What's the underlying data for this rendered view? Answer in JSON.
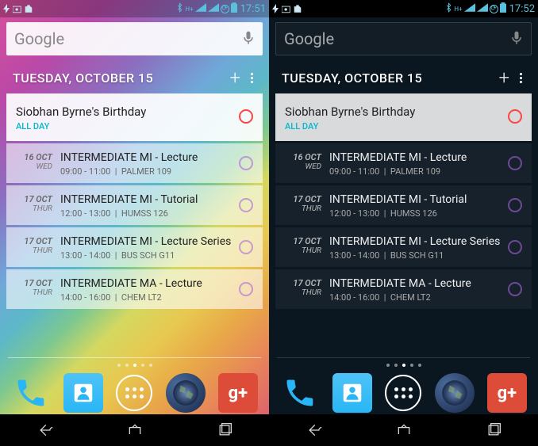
{
  "phones": [
    {
      "theme": "light",
      "time": "17:51"
    },
    {
      "theme": "dark",
      "time": "17:52"
    }
  ],
  "search": {
    "placeholder": "Google"
  },
  "widget": {
    "header": "TUESDAY, OCTOBER 15",
    "events": [
      {
        "first": true,
        "title": "Siobhan Byrne's Birthday",
        "allday": "ALL DAY",
        "ring": "red"
      },
      {
        "date": "16 OCT",
        "day": "WED",
        "title": "INTERMEDIATE MI - Lecture",
        "time": "09:00 - 11:00",
        "loc": "PALMER 109",
        "ring": "purple"
      },
      {
        "date": "17 OCT",
        "day": "THUR",
        "title": "INTERMEDIATE MI - Tutorial",
        "time": "12:00 - 13:00",
        "loc": "HUMSS 126",
        "ring": "purple"
      },
      {
        "date": "17 OCT",
        "day": "THUR",
        "title": "INTERMEDIATE MI - Lecture Series",
        "time": "13:00 - 14:00",
        "loc": "BUS SCH G11",
        "ring": "purple"
      },
      {
        "date": "17 OCT",
        "day": "THUR",
        "title": "INTERMEDIATE MA - Lecture",
        "time": "14:00 - 16:00",
        "loc": "CHEM LT2",
        "ring": "purple"
      }
    ]
  },
  "dock": [
    "phone",
    "contacts",
    "apps",
    "browser",
    "gplus"
  ]
}
